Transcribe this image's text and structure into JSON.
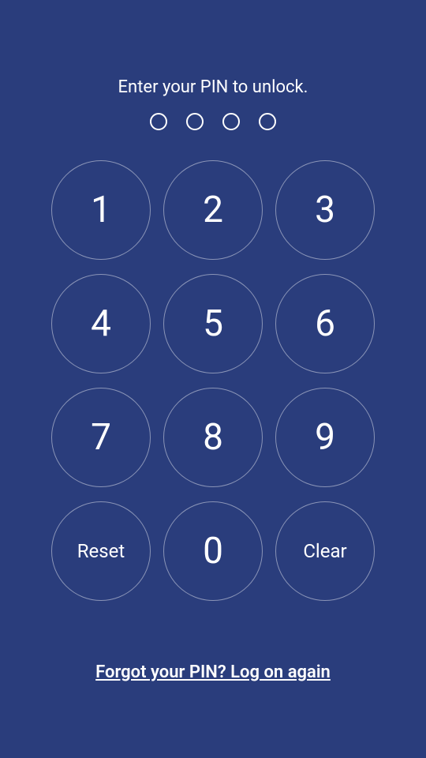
{
  "prompt": "Enter your PIN to unlock.",
  "pin_length": 4,
  "keypad": {
    "keys": [
      {
        "label": "1"
      },
      {
        "label": "2"
      },
      {
        "label": "3"
      },
      {
        "label": "4"
      },
      {
        "label": "5"
      },
      {
        "label": "6"
      },
      {
        "label": "7"
      },
      {
        "label": "8"
      },
      {
        "label": "9"
      },
      {
        "label": "Reset"
      },
      {
        "label": "0"
      },
      {
        "label": "Clear"
      }
    ]
  },
  "forgot_link": "Forgot your PIN? Log on again"
}
